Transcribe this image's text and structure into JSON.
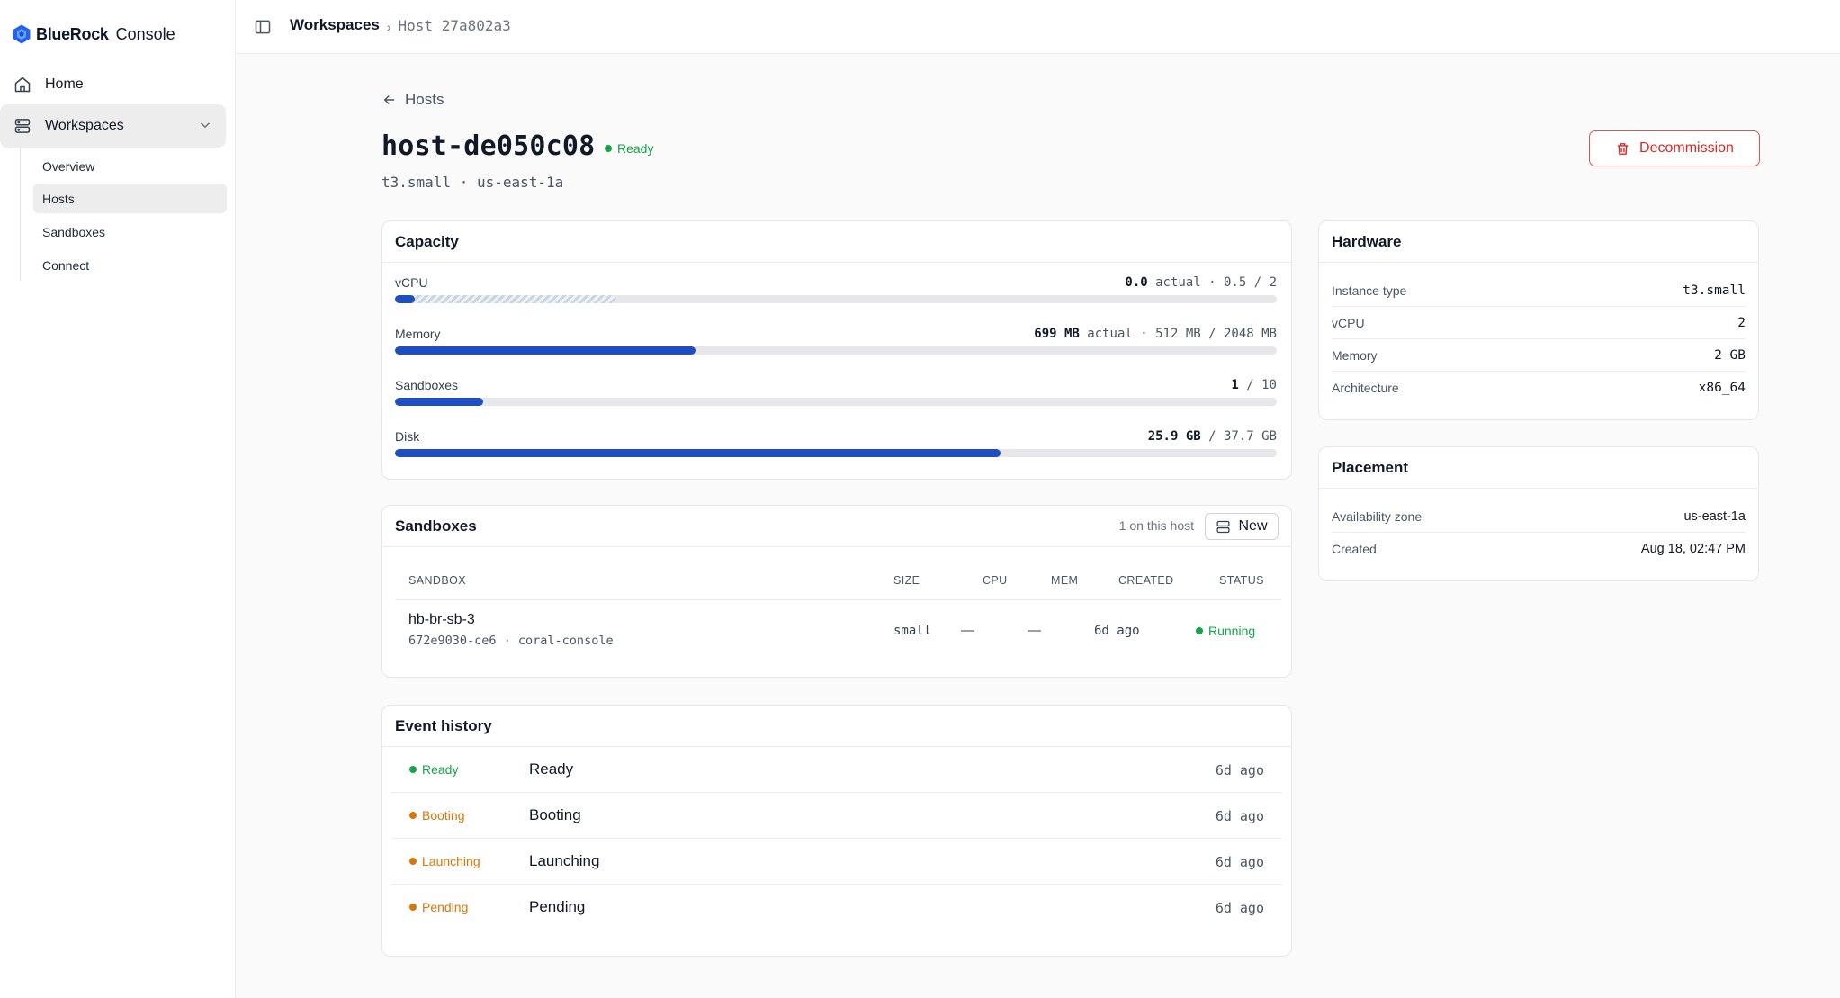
{
  "brand": {
    "name_bold": "BlueRock",
    "name_rest": "Console",
    "icon": "hexagon-logo-icon",
    "color": "#2563eb"
  },
  "sidebar": {
    "items": [
      {
        "label": "Home",
        "icon": "home-icon"
      },
      {
        "label": "Workspaces",
        "icon": "server-stack-icon",
        "expanded": true
      }
    ],
    "subitems": [
      {
        "label": "Overview"
      },
      {
        "label": "Hosts",
        "active": true
      },
      {
        "label": "Sandboxes"
      },
      {
        "label": "Connect"
      }
    ]
  },
  "topbar": {
    "breadcrumb": [
      "Workspaces",
      "Host 27a802a3"
    ],
    "separator": "›"
  },
  "header": {
    "back_label": "Hosts",
    "title": "host-de050c08",
    "status": "Ready",
    "subtitle": "t3.small · us-east-1a",
    "decommission_label": "Decommission"
  },
  "capacity": {
    "title": "Capacity",
    "meters": [
      {
        "label": "vCPU",
        "value_bold": "0.0",
        "value_rest": " actual · 0.5 / 2",
        "fill_fraction": 0.0,
        "reserved_fraction": 0.25
      },
      {
        "label": "Memory",
        "value_bold": "699 MB",
        "value_rest": " actual · 512 MB / 2048 MB",
        "fill_fraction": 0.341
      },
      {
        "label": "Sandboxes",
        "value_bold": "1",
        "value_rest": " / 10",
        "fill_fraction": 0.1
      },
      {
        "label": "Disk",
        "value_bold": "25.9 GB",
        "value_rest": " / 37.7 GB",
        "fill_fraction": 0.687
      }
    ]
  },
  "sandboxes": {
    "title": "Sandboxes",
    "count_label": "1 on this host",
    "new_label": "New",
    "columns": [
      "SANDBOX",
      "SIZE",
      "CPU",
      "MEM",
      "CREATED",
      "STATUS"
    ],
    "rows": [
      {
        "name": "hb-br-sb-3",
        "meta": "672e9030-ce6 · coral-console",
        "size": "small",
        "cpu": "—",
        "mem": "—",
        "created": "6d ago",
        "status": "Running"
      }
    ]
  },
  "events": {
    "title": "Event history",
    "rows": [
      {
        "badge": "Ready",
        "text": "Ready",
        "time": "6d ago",
        "color": "#16a34a"
      },
      {
        "badge": "Booting",
        "text": "Booting",
        "time": "6d ago",
        "color": "#d97706"
      },
      {
        "badge": "Launching",
        "text": "Launching",
        "time": "6d ago",
        "color": "#d97706"
      },
      {
        "badge": "Pending",
        "text": "Pending",
        "time": "6d ago",
        "color": "#d97706"
      }
    ]
  },
  "hardware": {
    "title": "Hardware",
    "rows": [
      {
        "key": "Instance type",
        "value": "t3.small"
      },
      {
        "key": "vCPU",
        "value": "2"
      },
      {
        "key": "Memory",
        "value": "2 GB"
      },
      {
        "key": "Architecture",
        "value": "x86_64"
      }
    ]
  },
  "placement": {
    "title": "Placement",
    "rows": [
      {
        "key": "Availability zone",
        "value": "us-east-1a"
      },
      {
        "key": "Created",
        "value": "Aug 18, 02:47 PM"
      }
    ]
  },
  "colors": {
    "accent": "#1e4fc2",
    "success": "#16a34a",
    "warning": "#d97706",
    "danger": "#dc2626"
  }
}
